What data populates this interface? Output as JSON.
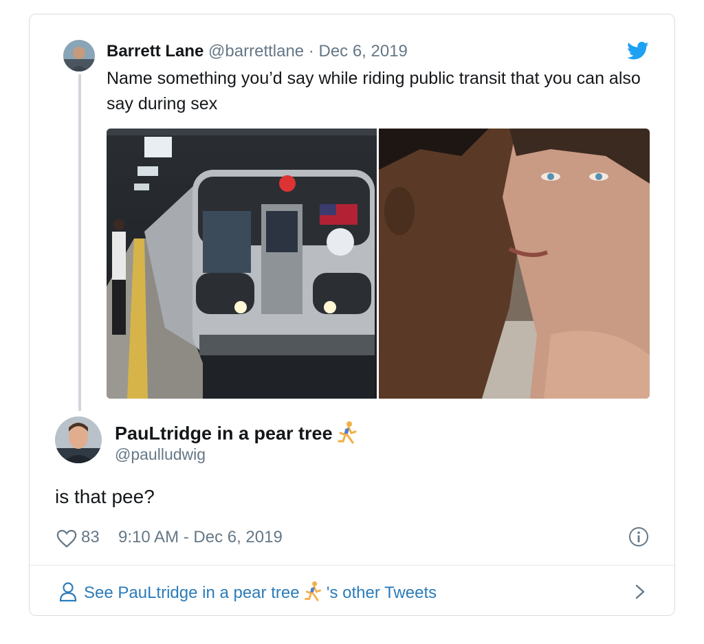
{
  "quoted_tweet": {
    "author_name": "Barrett Lane",
    "handle": "@barrettlane",
    "separator": " · ",
    "date": "Dec 6, 2019",
    "text": "Name something you’d say while riding public transit that you can also say during sex",
    "media": [
      {
        "description": "subway-train-photo"
      },
      {
        "description": "two-men-photo"
      }
    ]
  },
  "reply": {
    "author_name": "PauLtridge in a pear tree",
    "handle": "@paulludwig",
    "text": "is that pee?",
    "likes": "83",
    "timestamp": "9:10 AM - Dec 6, 2019"
  },
  "footer": {
    "prefix": "See PauLtridge in a pear tree",
    "suffix": "'s other Tweets"
  },
  "icons": [
    "twitter-bird-icon",
    "heart-icon",
    "info-icon",
    "person-icon",
    "chevron-right-icon",
    "runner-emoji-icon"
  ],
  "colors": {
    "twitter_blue": "#1da1f2",
    "link_blue": "#2b7bb9",
    "muted": "#657786",
    "border": "#d6dde3"
  }
}
